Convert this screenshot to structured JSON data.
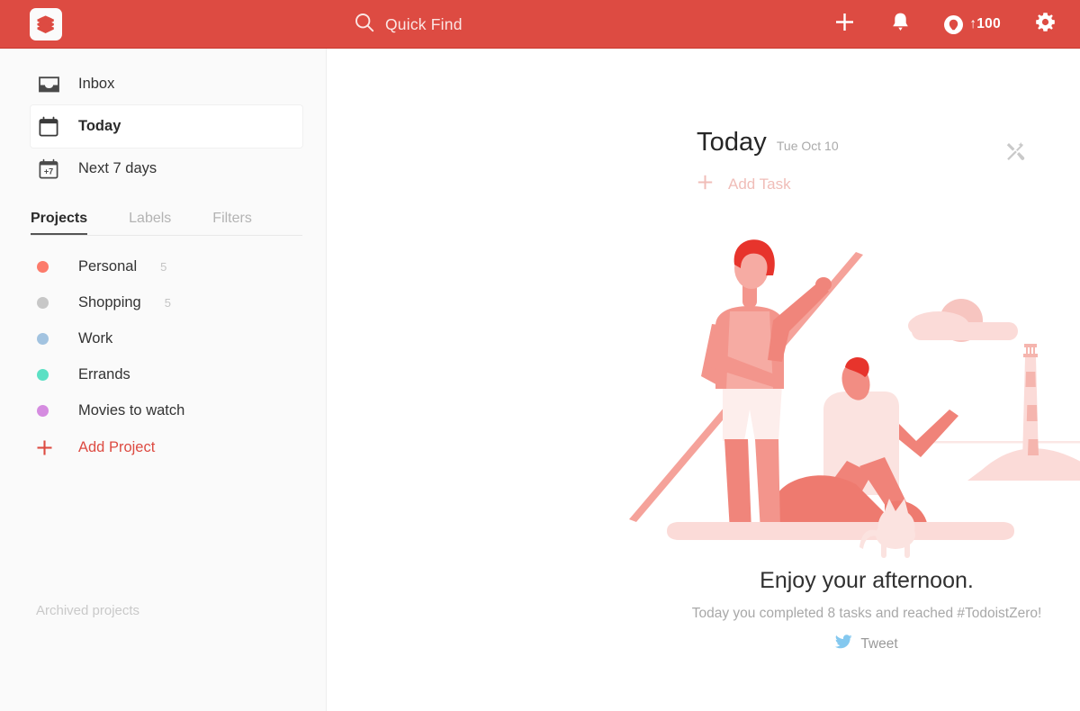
{
  "theme": {
    "brand_red": "#dd4b42",
    "sidebar_bg": "#fafafa",
    "accent_text": "#dd4b42"
  },
  "header": {
    "logo_icon": "todoist-logo-icon",
    "search": {
      "icon": "search-icon",
      "placeholder": "Quick Find",
      "value": ""
    },
    "add_icon": "plus-icon",
    "notifications_icon": "bell-icon",
    "karma": {
      "icon": "karma-droplet-icon",
      "label": "↑100"
    },
    "settings_icon": "gear-icon"
  },
  "sidebar": {
    "nav": [
      {
        "label": "Inbox",
        "icon": "inbox-icon",
        "active": false
      },
      {
        "label": "Today",
        "icon": "calendar-icon",
        "active": true
      },
      {
        "label": "Next 7 days",
        "icon": "calendar-plus7-icon",
        "active": false
      }
    ],
    "tabs": [
      {
        "label": "Projects",
        "active": true
      },
      {
        "label": "Labels",
        "active": false
      },
      {
        "label": "Filters",
        "active": false
      }
    ],
    "projects": [
      {
        "name": "Personal",
        "count": "5",
        "color": "#fc7b6b"
      },
      {
        "name": "Shopping",
        "count": "5",
        "color": "#c7c7c7"
      },
      {
        "name": "Work",
        "count": "",
        "color": "#a2c3e0"
      },
      {
        "name": "Errands",
        "count": "",
        "color": "#5ce0c4"
      },
      {
        "name": "Movies to watch",
        "count": "",
        "color": "#d58ce0"
      }
    ],
    "add_project": {
      "label": "Add Project",
      "icon": "plus-icon"
    },
    "archived_label": "Archived projects"
  },
  "main": {
    "title": "Today",
    "date": "Tue Oct 10",
    "tools_icon": "tools-icon",
    "add_task": {
      "label": "Add Task",
      "icon": "plus-icon"
    },
    "empty_state": {
      "illustration": "beach-paddleboard-illustration",
      "title": "Enjoy your afternoon.",
      "subtitle": "Today you completed 8 tasks and reached #TodoistZero!",
      "tweet": {
        "icon": "twitter-bird-icon",
        "label": "Tweet"
      }
    }
  }
}
